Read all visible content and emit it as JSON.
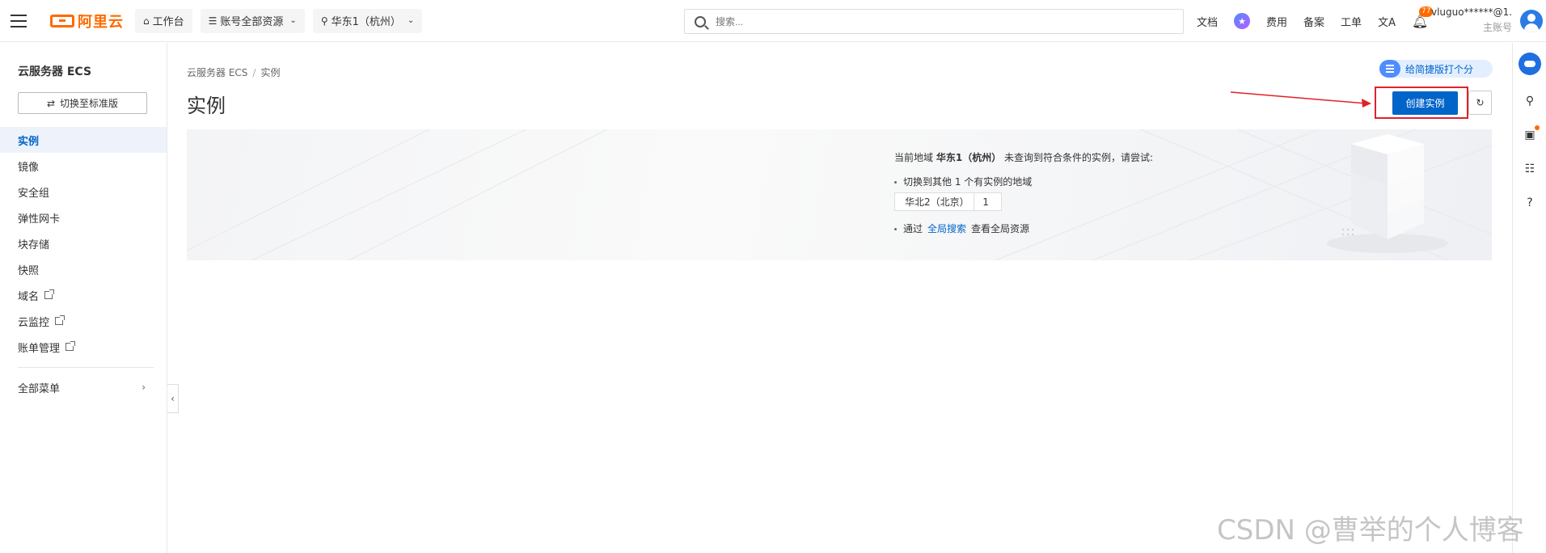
{
  "topbar": {
    "logo": "阿里云",
    "workbench": "工作台",
    "resources": "账号全部资源",
    "region": "华东1（杭州）",
    "search_placeholder": "搜索...",
    "nav": [
      "文档",
      "费用",
      "备案",
      "工单"
    ],
    "notification_count": "77",
    "user_name": "vluguo******@1...",
    "user_role": "主账号"
  },
  "sidebar": {
    "title": "云服务器 ECS",
    "switch_label": "切换至标准版",
    "items": [
      {
        "label": "实例",
        "active": true
      },
      {
        "label": "镜像"
      },
      {
        "label": "安全组"
      },
      {
        "label": "弹性网卡"
      },
      {
        "label": "块存储"
      },
      {
        "label": "快照"
      },
      {
        "label": "域名",
        "external": true
      },
      {
        "label": "云监控",
        "external": true
      },
      {
        "label": "账单管理",
        "external": true
      }
    ],
    "all_menu": "全部菜单"
  },
  "main": {
    "breadcrumb": [
      "云服务器 ECS",
      "实例"
    ],
    "title": "实例",
    "feedback_label": "给简捷版打个分",
    "create_button": "创建实例",
    "empty": {
      "prefix": "当前地域",
      "region": "华东1（杭州）",
      "suffix": "未查询到符合条件的实例，请尝试:",
      "tip1": "切换到其他 1 个有实例的地域",
      "region_tag": {
        "name": "华北2（北京）",
        "count": "1"
      },
      "tip2_prefix": "通过",
      "tip2_link": "全局搜索",
      "tip2_suffix": "查看全局资源"
    }
  },
  "watermark": "CSDN @曹举的个人博客",
  "colors": {
    "brand": "#ff6a00",
    "primary": "#0064c8",
    "annotation": "#e0212a"
  }
}
